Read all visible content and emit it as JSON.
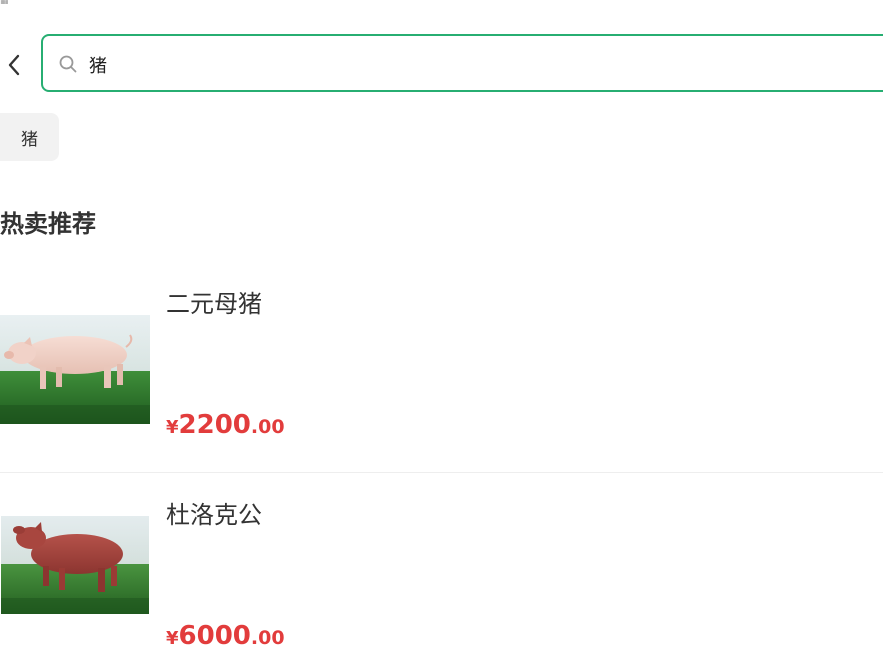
{
  "search": {
    "value": "猪",
    "placeholder": ""
  },
  "history": {
    "items": [
      {
        "label": "猪"
      }
    ]
  },
  "recommend": {
    "title": "热卖推荐",
    "products": [
      {
        "name": "二元母猪",
        "currency": "¥",
        "price_int": "2200",
        "price_dec": ".00",
        "image": "white-pig-on-grass"
      },
      {
        "name": "杜洛克公",
        "currency": "¥",
        "price_int": "6000",
        "price_dec": ".00",
        "image": "red-duroc-pig-on-grass"
      }
    ]
  },
  "colors": {
    "accent": "#27ae72",
    "price": "#e23c3c",
    "chip_bg": "#f2f2f2"
  }
}
